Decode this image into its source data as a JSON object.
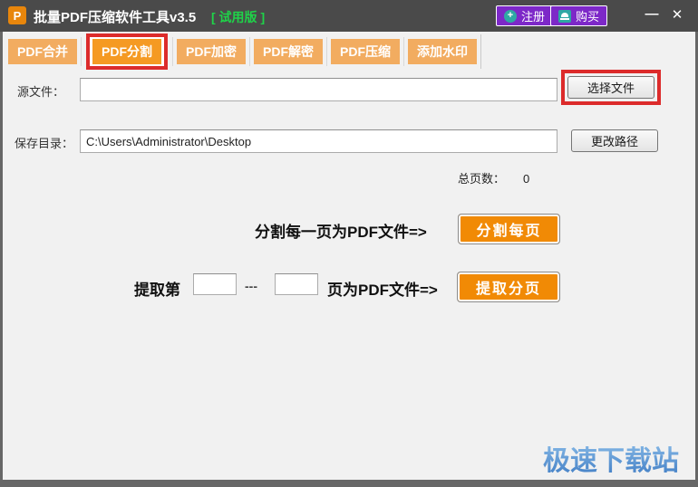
{
  "window": {
    "title": "批量PDF压缩软件工具v3.5",
    "trial_badge": "[ 试用版 ]",
    "app_icon_letter": "P",
    "register_label": "注册",
    "buy_label": "购买",
    "minimize_glyph": "—",
    "close_glyph": "✕"
  },
  "tabs": [
    {
      "label": "PDF合并",
      "active": false
    },
    {
      "label": "PDF分割",
      "active": true
    },
    {
      "label": "PDF加密",
      "active": false
    },
    {
      "label": "PDF解密",
      "active": false
    },
    {
      "label": "PDF压缩",
      "active": false
    },
    {
      "label": "添加水印",
      "active": false
    }
  ],
  "form": {
    "source_label": "源文件：",
    "source_value": "",
    "choose_file_button": "选择文件",
    "save_dir_label": "保存目录：",
    "save_dir_value": "C:\\Users\\Administrator\\Desktop",
    "change_path_button": "更改路径",
    "total_pages_label": "总页数：",
    "total_pages_value": "0",
    "split_caption": "分割每一页为PDF文件=>",
    "split_button": "分割每页",
    "extract_prefix": "提取第",
    "range_separator": "---",
    "extract_from_value": "",
    "extract_to_value": "",
    "extract_suffix": "页为PDF文件=>",
    "extract_button": "提取分页"
  },
  "watermark": "极速下载站",
  "colors": {
    "titlebar_gray": "#4A4A4A",
    "tab_inactive_orange": "#F2AC60",
    "tab_active_orange": "#F59A23",
    "action_button_orange": "#F18A05",
    "annotation_red": "#DC2B2B",
    "titlebar_button_purple": "#7D28C8",
    "trial_green": "#1FD349",
    "watermark_blue": "#5695D3",
    "icon_teal": "#2FA8A4"
  }
}
